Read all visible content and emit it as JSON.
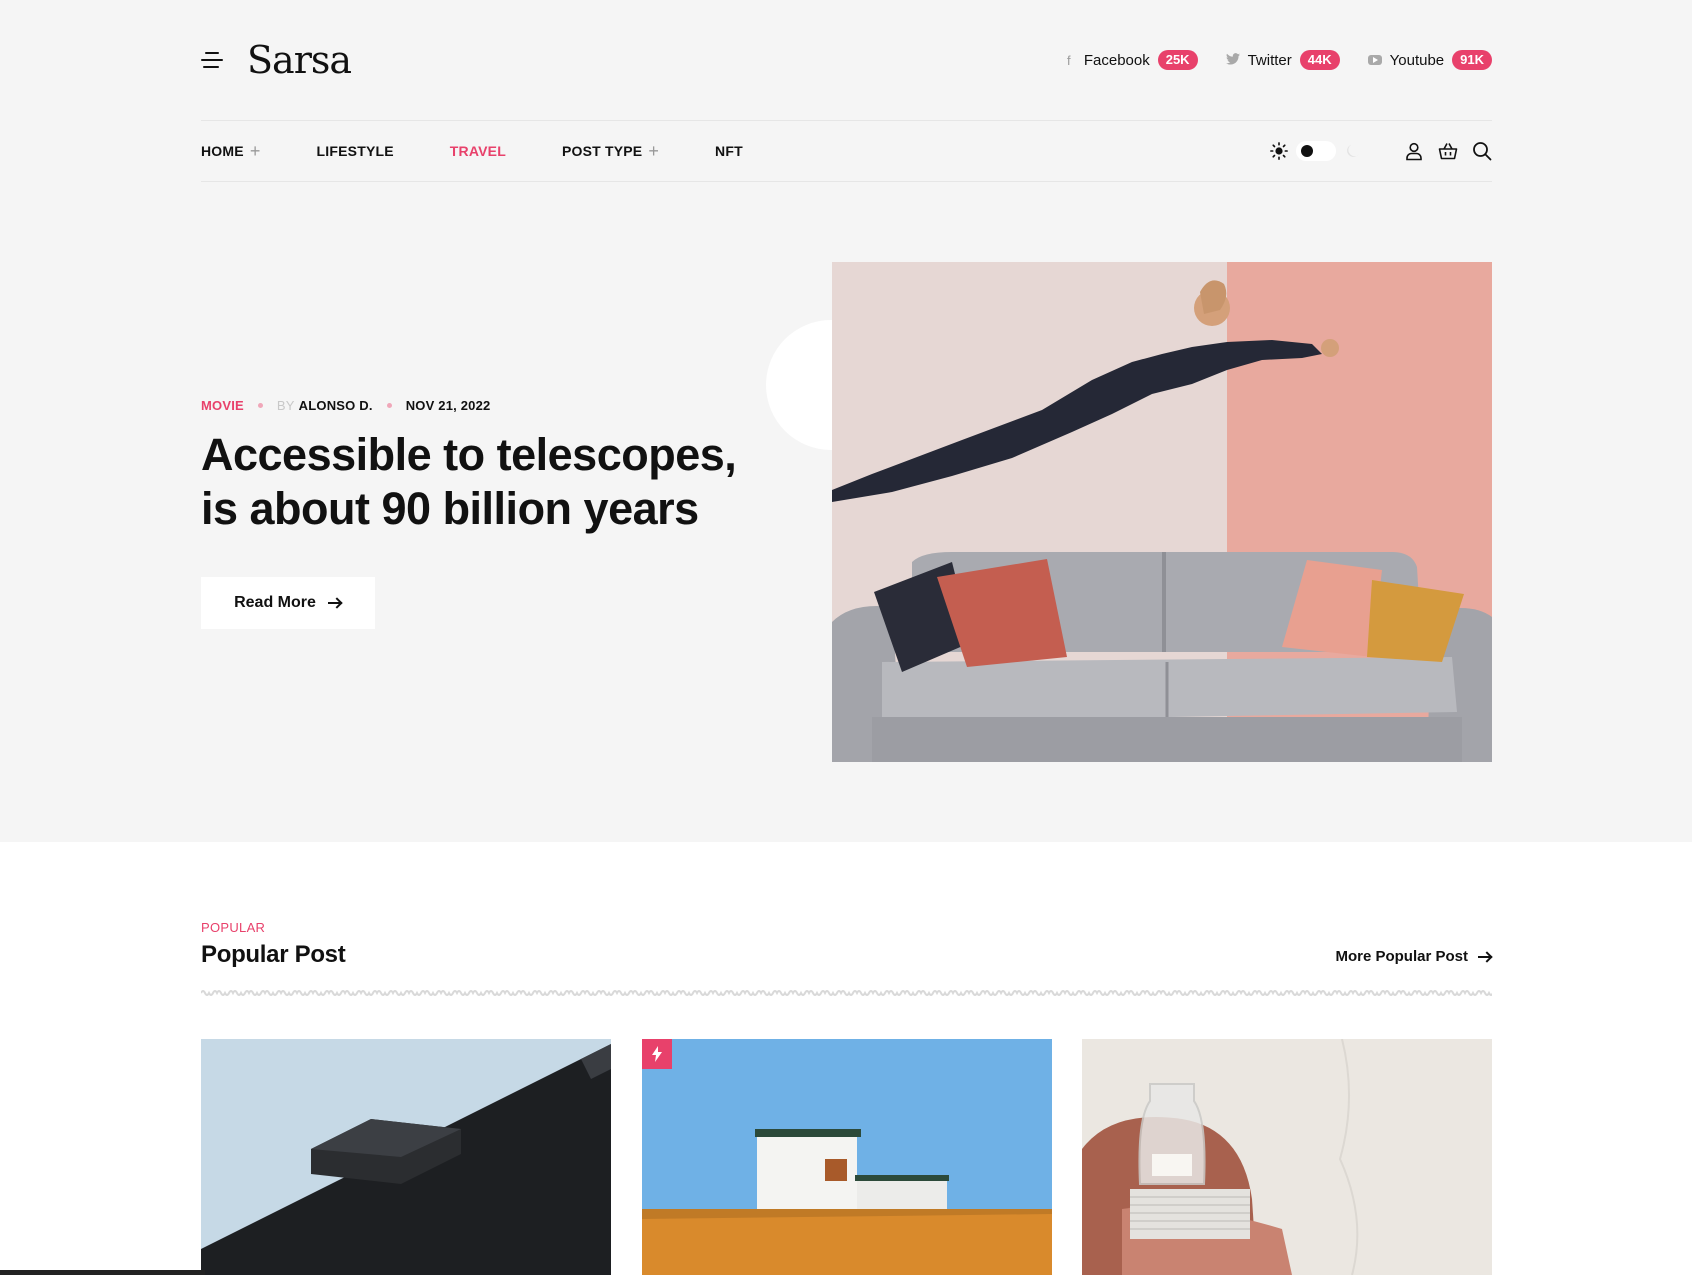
{
  "brand": {
    "logo": "Sarsa"
  },
  "socials": [
    {
      "name": "Facebook",
      "count": "25K",
      "icon": "facebook-icon"
    },
    {
      "name": "Twitter",
      "count": "44K",
      "icon": "twitter-icon"
    },
    {
      "name": "Youtube",
      "count": "91K",
      "icon": "youtube-icon"
    }
  ],
  "nav": {
    "items": [
      {
        "label": "HOME",
        "has_plus": true
      },
      {
        "label": "LIFESTYLE",
        "has_plus": false
      },
      {
        "label": "TRAVEL",
        "has_plus": false,
        "active": true
      },
      {
        "label": "POST TYPE",
        "has_plus": true
      },
      {
        "label": "NFT",
        "has_plus": false
      }
    ],
    "plus_symbol": "+"
  },
  "hero": {
    "category": "MOVIE",
    "by": "BY",
    "author": "ALONSO D.",
    "date": "NOV 21, 2022",
    "title": "Accessible to telescopes, is about 90 billion years",
    "button": "Read More"
  },
  "popular": {
    "kicker": "POPULAR",
    "title": "Popular Post",
    "more_link": "More Popular Post"
  },
  "colors": {
    "accent": "#e8416b",
    "hero_bg": "#f5f5f5",
    "text": "#111111"
  }
}
